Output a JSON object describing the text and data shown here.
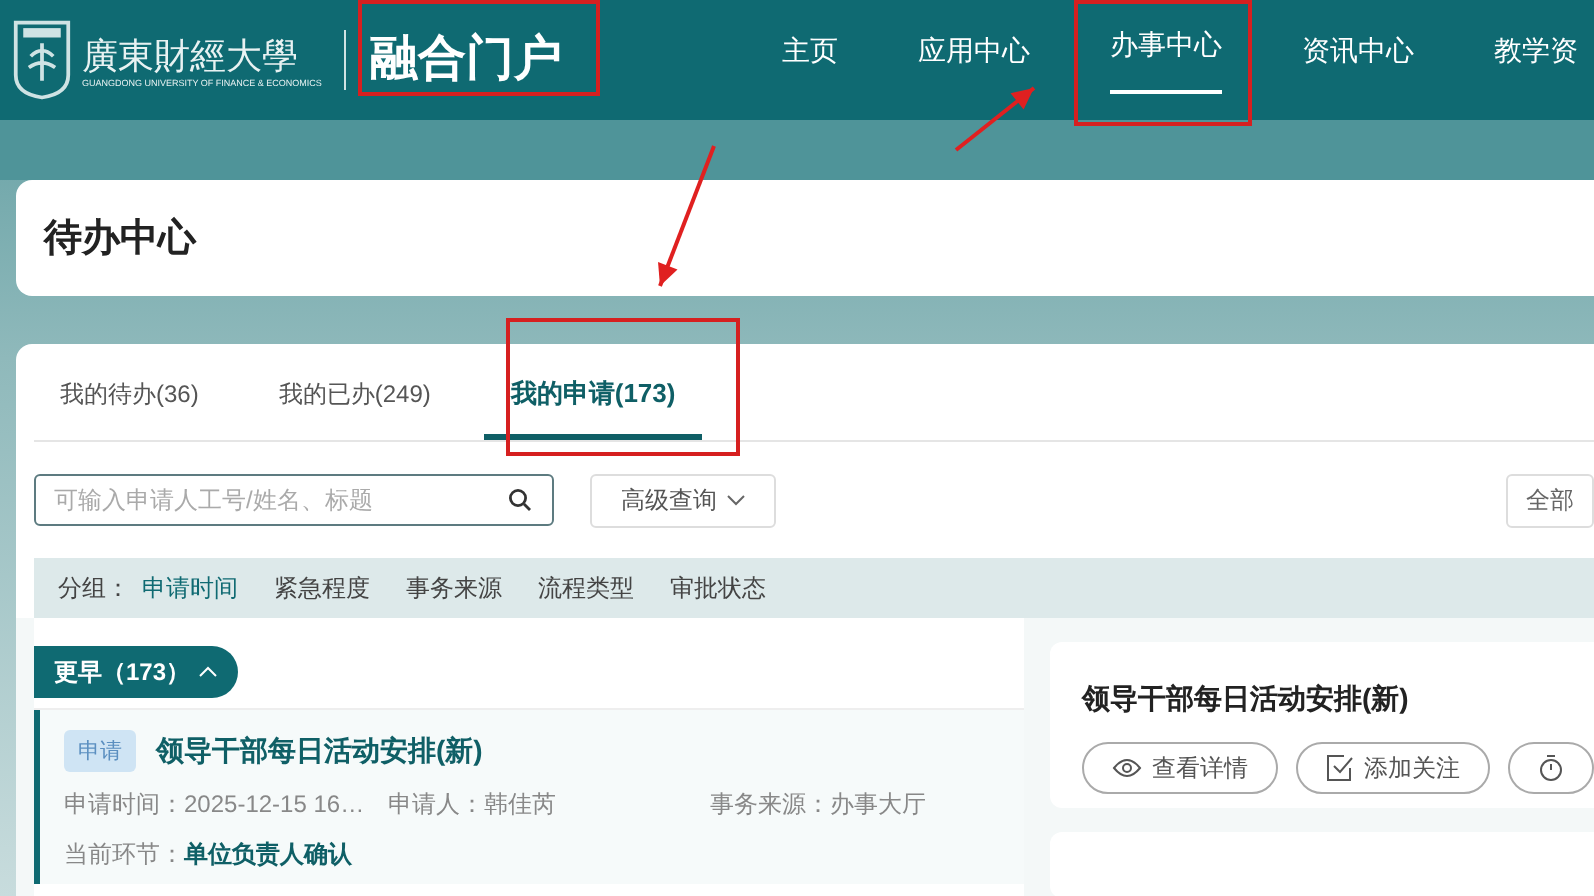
{
  "header": {
    "school_name": "廣東財經大學",
    "school_name_en": "GUANGDONG UNIVERSITY OF FINANCE & ECONOMICS",
    "portal_title": "融合门户"
  },
  "nav": [
    {
      "label": "主页",
      "selected": false
    },
    {
      "label": "应用中心",
      "selected": false
    },
    {
      "label": "办事中心",
      "selected": true
    },
    {
      "label": "资讯中心",
      "selected": false
    },
    {
      "label": "教学资",
      "selected": false
    }
  ],
  "page_title": "待办中心",
  "tabs": [
    {
      "label": "我的待办(36)",
      "selected": false
    },
    {
      "label": "我的已办(249)",
      "selected": false
    },
    {
      "label": "我的申请(173)",
      "selected": true
    }
  ],
  "search": {
    "placeholder": "可输入申请人工号/姓名、标题"
  },
  "advanced_search": "高级查询",
  "filter_all": "全部",
  "grouping": {
    "label": "分组：",
    "options": [
      {
        "label": "申请时间",
        "selected": true
      },
      {
        "label": "紧急程度",
        "selected": false
      },
      {
        "label": "事务来源",
        "selected": false
      },
      {
        "label": "流程类型",
        "selected": false
      },
      {
        "label": "审批状态",
        "selected": false
      }
    ]
  },
  "group": {
    "label": "更早（173）",
    "expanded": true
  },
  "items": [
    {
      "tag": "申请",
      "title": "领导干部每日活动安排(新)",
      "time": "申请时间：2025-12-15 16…",
      "applicant": "申请人：韩佳芮",
      "source": "事务来源：办事大厅",
      "step_label": "当前环节：",
      "step": "单位负责人确认"
    }
  ],
  "detail": {
    "title": "领导干部每日活动安排(新)",
    "actions": [
      {
        "kind": "view",
        "label": "查看详情"
      },
      {
        "kind": "follow",
        "label": "添加关注"
      },
      {
        "kind": "timer"
      }
    ]
  }
}
